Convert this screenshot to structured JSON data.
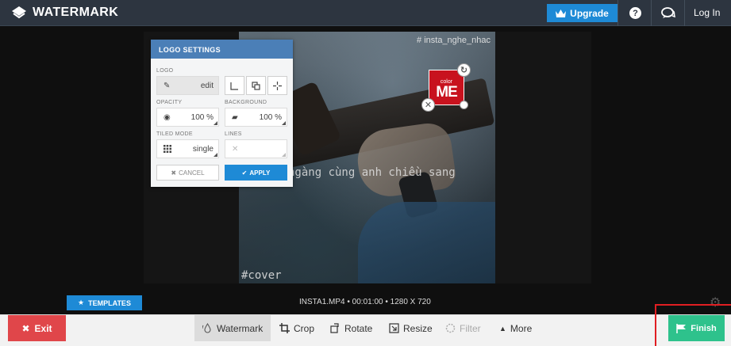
{
  "header": {
    "brand": "WATERMARK",
    "upgrade_label": "Upgrade",
    "login_label": "Log In"
  },
  "video": {
    "hashtag_top": "# insta_nghe_nhac",
    "caption": "ngàng cùng anh chiều sang",
    "hashtag_bottom": "#cover"
  },
  "watermark_logo": {
    "small_text": "color",
    "big_text": "ME",
    "background": "#c8121e"
  },
  "logo_settings": {
    "title": "LOGO SETTINGS",
    "logo_label": "LOGO",
    "logo_value": "edit",
    "opacity_label": "OPACITY",
    "opacity_value": "100 %",
    "background_label": "BACKGROUND",
    "background_value": "100 %",
    "tiled_mode_label": "TILED MODE",
    "tiled_mode_value": "single",
    "lines_label": "LINES",
    "cancel_label": "CANCEL",
    "apply_label": "APPLY"
  },
  "templates_label": "TEMPLATES",
  "file_info": "INSTA1.MP4 • 00:01:00 • 1280 X 720",
  "toolbar": {
    "exit_label": "Exit",
    "tools": [
      {
        "label": "Watermark",
        "state": "active"
      },
      {
        "label": "Crop",
        "state": "normal"
      },
      {
        "label": "Rotate",
        "state": "normal"
      },
      {
        "label": "Resize",
        "state": "normal"
      },
      {
        "label": "Filter",
        "state": "disabled"
      },
      {
        "label": "More",
        "state": "normal"
      }
    ],
    "finish_label": "Finish"
  },
  "colors": {
    "accent": "#1e8ad6",
    "exit": "#e0464a",
    "finish": "#2ec28c",
    "topbar": "#2d3540",
    "highlight_outline": "#e01e22"
  }
}
